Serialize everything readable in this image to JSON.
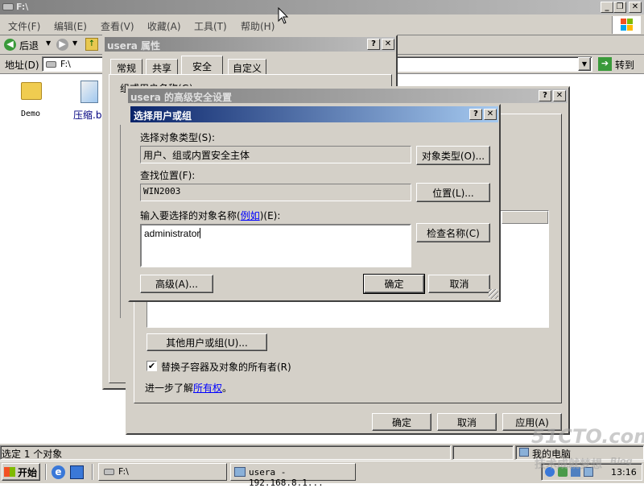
{
  "explorer": {
    "title": "F:\\",
    "menu": [
      "文件(F)",
      "编辑(E)",
      "查看(V)",
      "收藏(A)",
      "工具(T)",
      "帮助(H)"
    ],
    "back_label": "后退",
    "address_label": "地址(D)",
    "address_value": "F:\\",
    "go_label": "转到",
    "files": [
      "Demo",
      "压缩.b"
    ],
    "status_left": "选定 1 个对象",
    "status_right": "我的电脑"
  },
  "props": {
    "title": "usera 属性",
    "tabs": [
      "常规",
      "共享",
      "安全",
      "自定义"
    ],
    "group_label": "组或用户名称(G):"
  },
  "advsec": {
    "title": "usera 的高级安全设置",
    "other_users_button": "其他用户或组(U)...",
    "replace_owner_label": "替换子容器及对象的所有者(R)",
    "learn_more_prefix": "进一步了解",
    "learn_more_link": "所有权",
    "learn_more_suffix": "。",
    "ok": "确定",
    "cancel": "取消",
    "apply": "应用(A)"
  },
  "select_dialog": {
    "title": "选择用户或组",
    "object_type_label": "选择对象类型(S):",
    "object_type_value": "用户、组或内置安全主体",
    "object_type_button": "对象类型(O)...",
    "location_label": "查找位置(F):",
    "location_value": "WIN2003",
    "location_button": "位置(L)...",
    "enter_names_prefix": "输入要选择的对象名称(",
    "enter_names_link": "例如",
    "enter_names_suffix": ")(E):",
    "names_value": "administrator",
    "check_names_button": "检查名称(C)",
    "advanced_button": "高级(A)...",
    "ok": "确定",
    "cancel": "取消"
  },
  "taskbar": {
    "start": "开始",
    "tasks": [
      "F:\\",
      "usera - 192.168.8.1..."
    ],
    "clock": "13:16"
  },
  "watermark": [
    "51CTO.com",
    "技术成就梦想",
    "Blog"
  ],
  "colors": {
    "desktop_white": "#ffffff",
    "window_face": "#d4d0c8",
    "active_title": "#0a246a",
    "active_title_end": "#a6caf0",
    "inactive_title": "#808080",
    "inactive_title_end": "#c0c0c0",
    "link": "#0000ff"
  }
}
